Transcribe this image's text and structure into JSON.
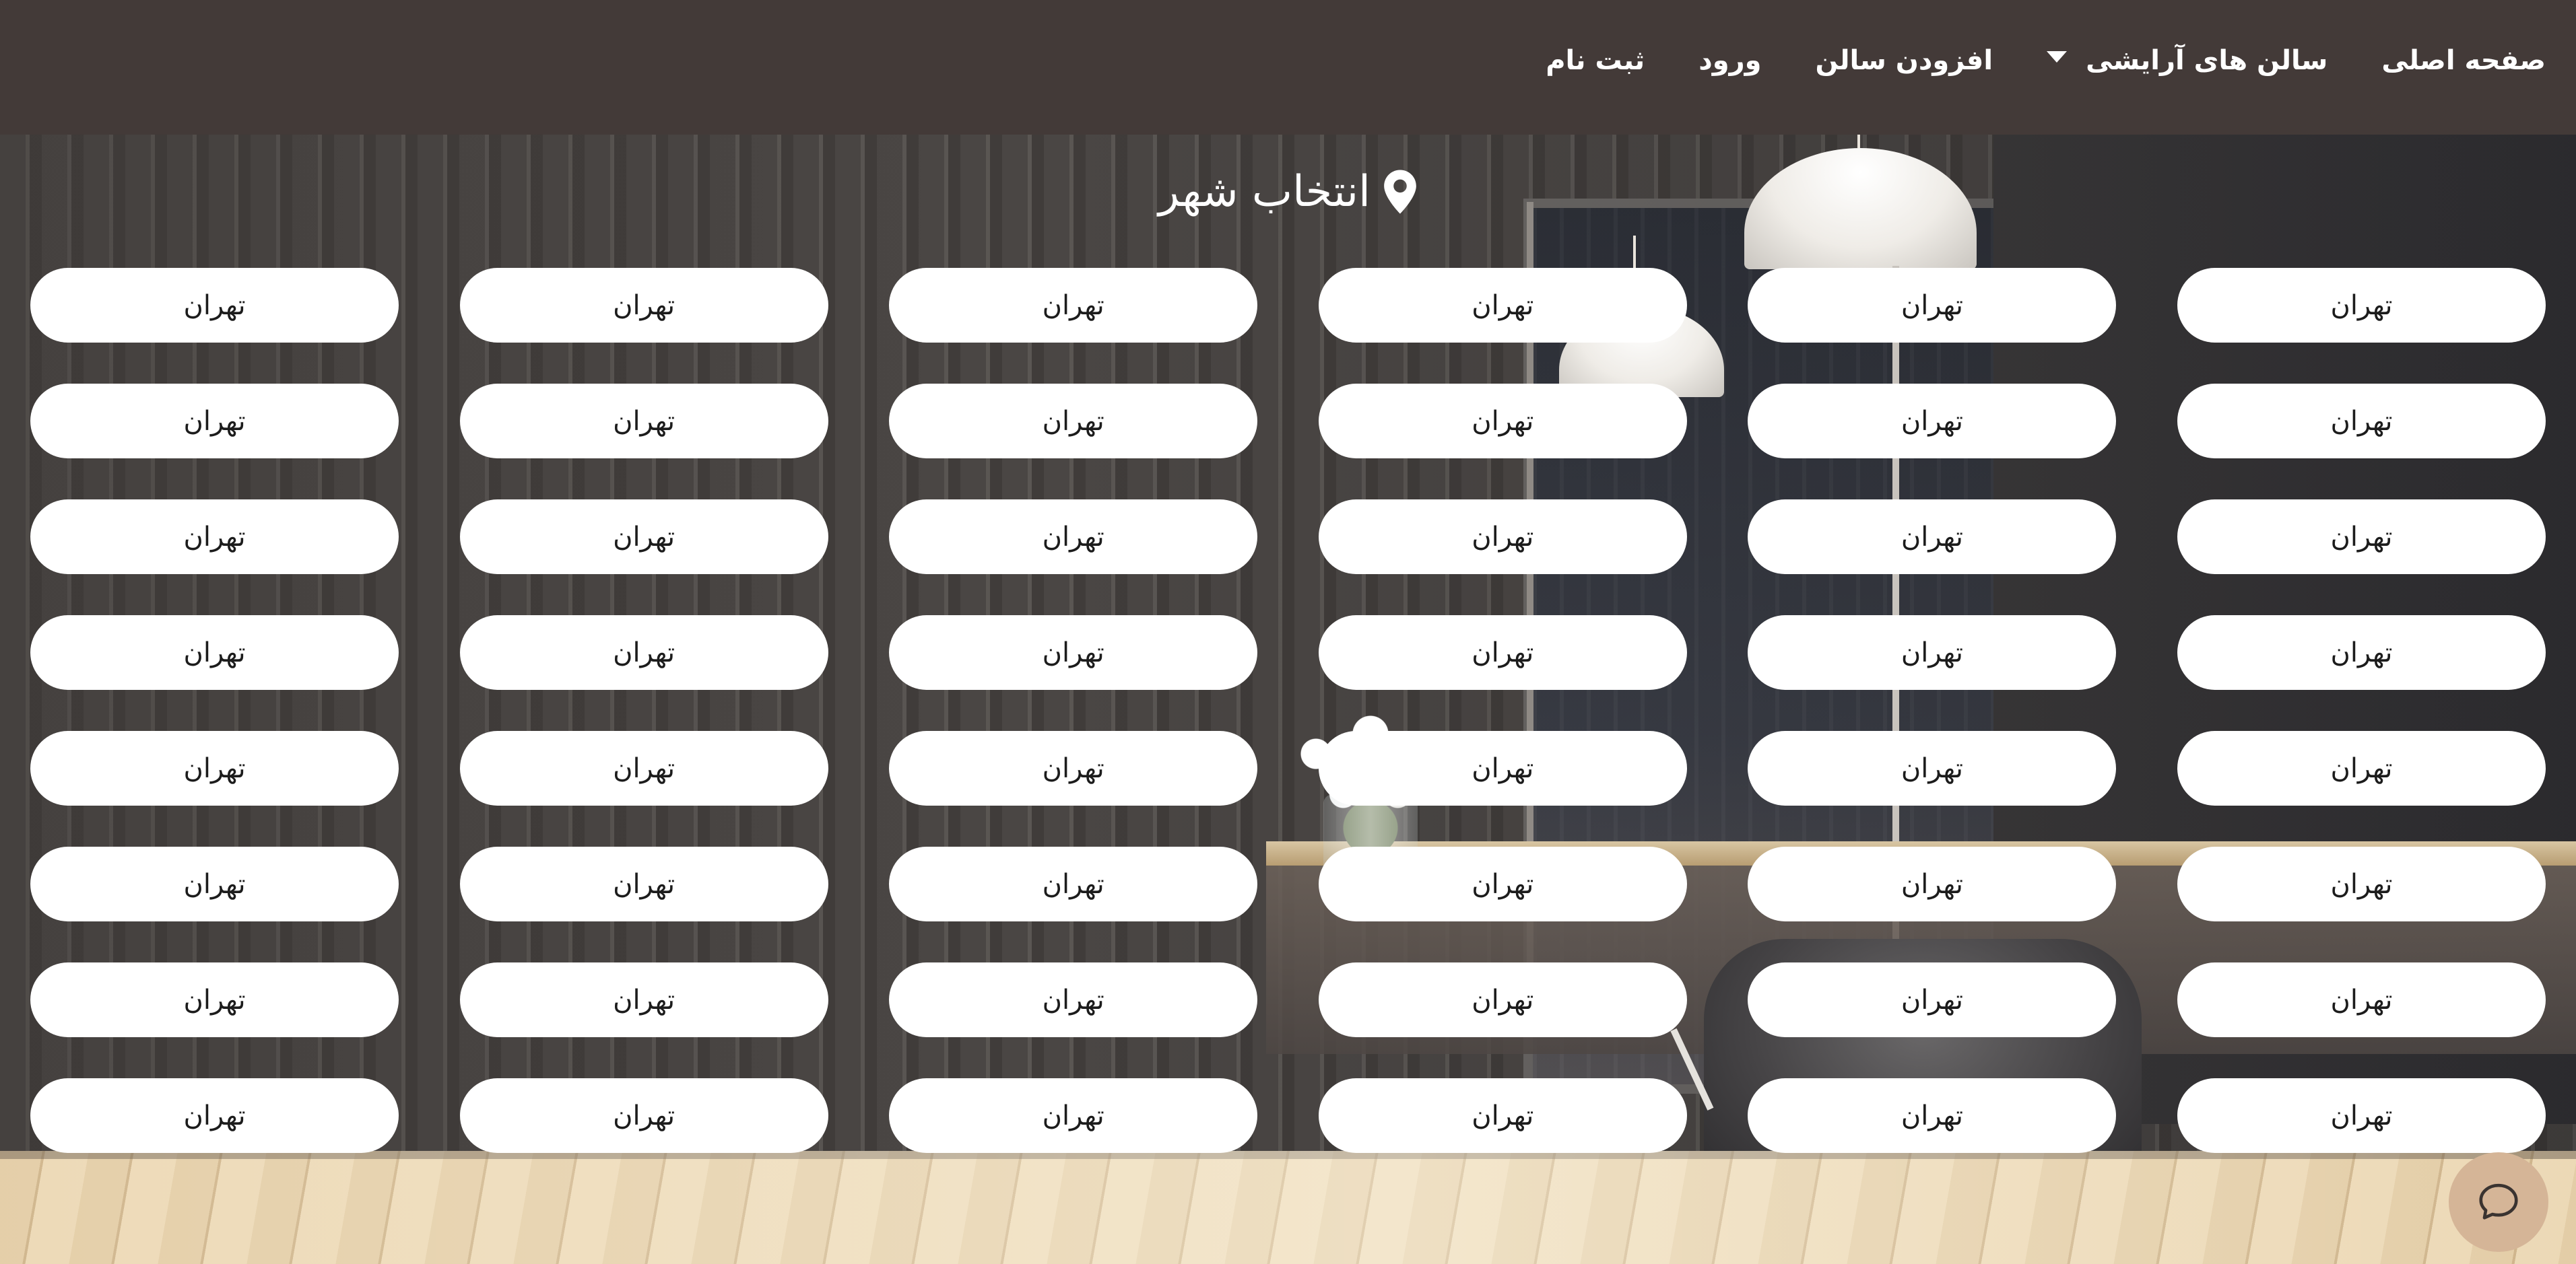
{
  "navbar": {
    "items": [
      {
        "label": "صفحه اصلی"
      },
      {
        "label": "سالن های آرایشی",
        "has_dropdown": true
      },
      {
        "label": "افزودن سالن"
      },
      {
        "label": "ورود"
      },
      {
        "label": "ثبت نام"
      }
    ]
  },
  "hero": {
    "title": "انتخاب شهر",
    "title_icon": "map-pin-icon"
  },
  "cities": {
    "rows": [
      [
        "تهران",
        "تهران",
        "تهران",
        "تهران",
        "تهران",
        "تهران"
      ],
      [
        "تهران",
        "تهران",
        "تهران",
        "تهران",
        "تهران",
        "تهران"
      ],
      [
        "تهران",
        "تهران",
        "تهران",
        "تهران",
        "تهران",
        "تهران"
      ],
      [
        "تهران",
        "تهران",
        "تهران",
        "تهران",
        "تهران",
        "تهران"
      ],
      [
        "تهران",
        "تهران",
        "تهران",
        "تهران",
        "تهران",
        "تهران"
      ],
      [
        "تهران",
        "تهران",
        "تهران",
        "تهران",
        "تهران",
        "تهران"
      ],
      [
        "تهران",
        "تهران",
        "تهران",
        "تهران",
        "تهران",
        "تهران"
      ],
      [
        "تهران",
        "تهران",
        "تهران",
        "تهران",
        "تهران",
        "تهران"
      ]
    ]
  },
  "chat": {
    "icon": "chat-bubble-icon"
  },
  "colors": {
    "navbar_bg": "#433a38",
    "pill_bg": "#ffffff",
    "chat_button_bg": "#d5b597",
    "text_light": "#ffffff"
  }
}
